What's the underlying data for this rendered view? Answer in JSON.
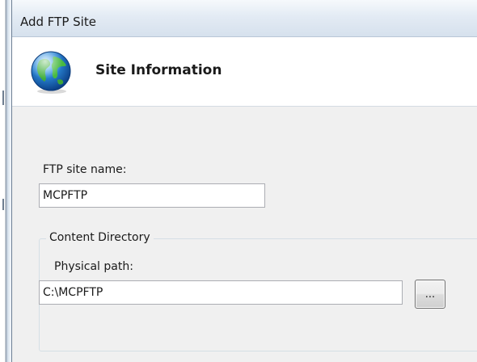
{
  "window": {
    "title": "Add FTP Site"
  },
  "header": {
    "icon": "globe-icon",
    "title": "Site Information"
  },
  "site_name": {
    "label": "FTP site name:",
    "value": "MCPFTP"
  },
  "content_directory": {
    "legend": "Content Directory",
    "physical_path_label": "Physical path:",
    "physical_path_value": "C:\\MCPFTP",
    "browse_label": "..."
  },
  "colors": {
    "titlebar": "#dde6f0",
    "body_background": "#f0f0f0",
    "input_border": "#abadb3"
  }
}
